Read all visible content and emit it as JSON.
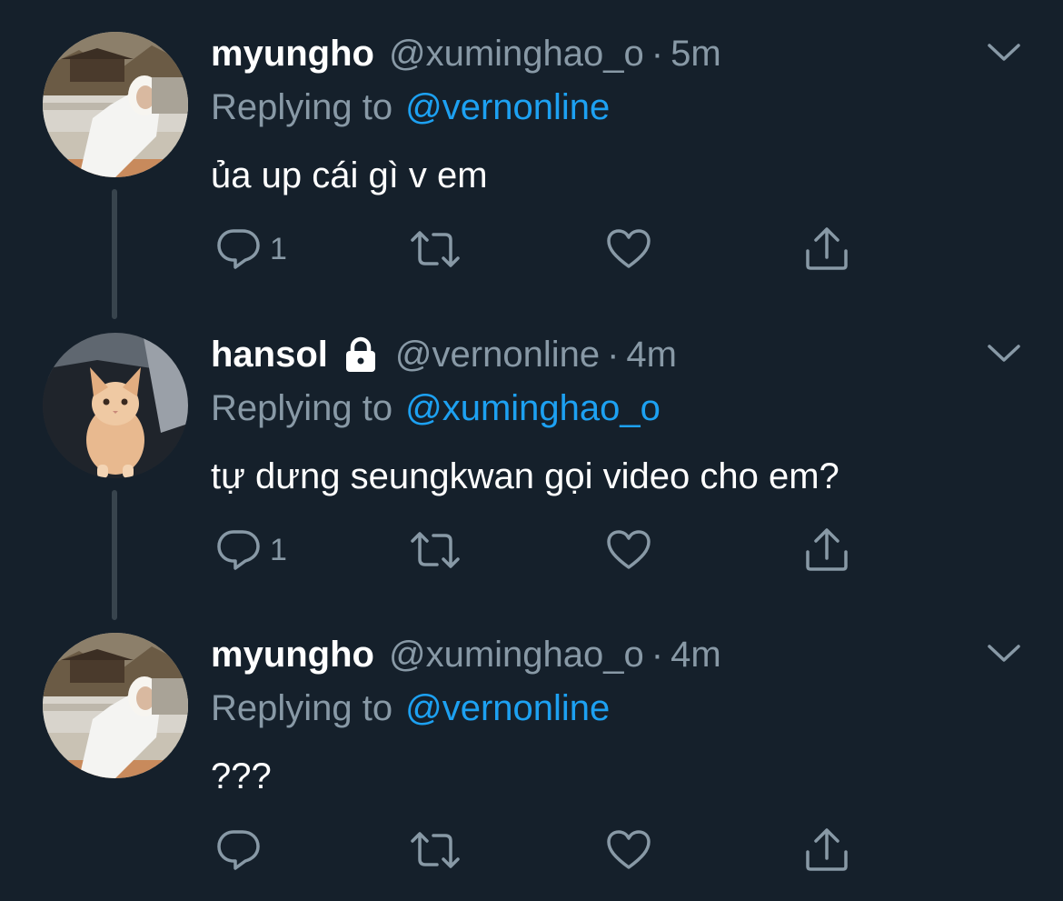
{
  "colors": {
    "background": "#15202b",
    "primary_text": "#ffffff",
    "secondary_text": "#8899a6",
    "link": "#1da1f2",
    "thread_line": "#38444d"
  },
  "tweets": [
    {
      "name": "myungho",
      "handle": "@xuminghao_o",
      "separator": "·",
      "time": "5m",
      "replying_label": "Replying to",
      "replying_to": "@vernonline",
      "text": "ủa up cái gì v em",
      "reply_count": "1",
      "locked": false,
      "avatar": "person-in-white-hoodie-avatar"
    },
    {
      "name": "hansol",
      "handle": "@vernonline",
      "separator": "·",
      "time": "4m",
      "replying_label": "Replying to",
      "replying_to": "@xuminghao_o",
      "text": "tự dưng seungkwan gọi video cho em?",
      "reply_count": "1",
      "locked": true,
      "avatar": "orange-kitten-avatar"
    },
    {
      "name": "myungho",
      "handle": "@xuminghao_o",
      "separator": "·",
      "time": "4m",
      "replying_label": "Replying to",
      "replying_to": "@vernonline",
      "text": "???",
      "reply_count": "",
      "locked": false,
      "avatar": "person-in-white-hoodie-avatar"
    }
  ],
  "icons": {
    "reply": "reply-icon",
    "retweet": "retweet-icon",
    "like": "heart-icon",
    "share": "share-icon",
    "more": "chevron-down-icon",
    "protected": "lock-icon"
  }
}
